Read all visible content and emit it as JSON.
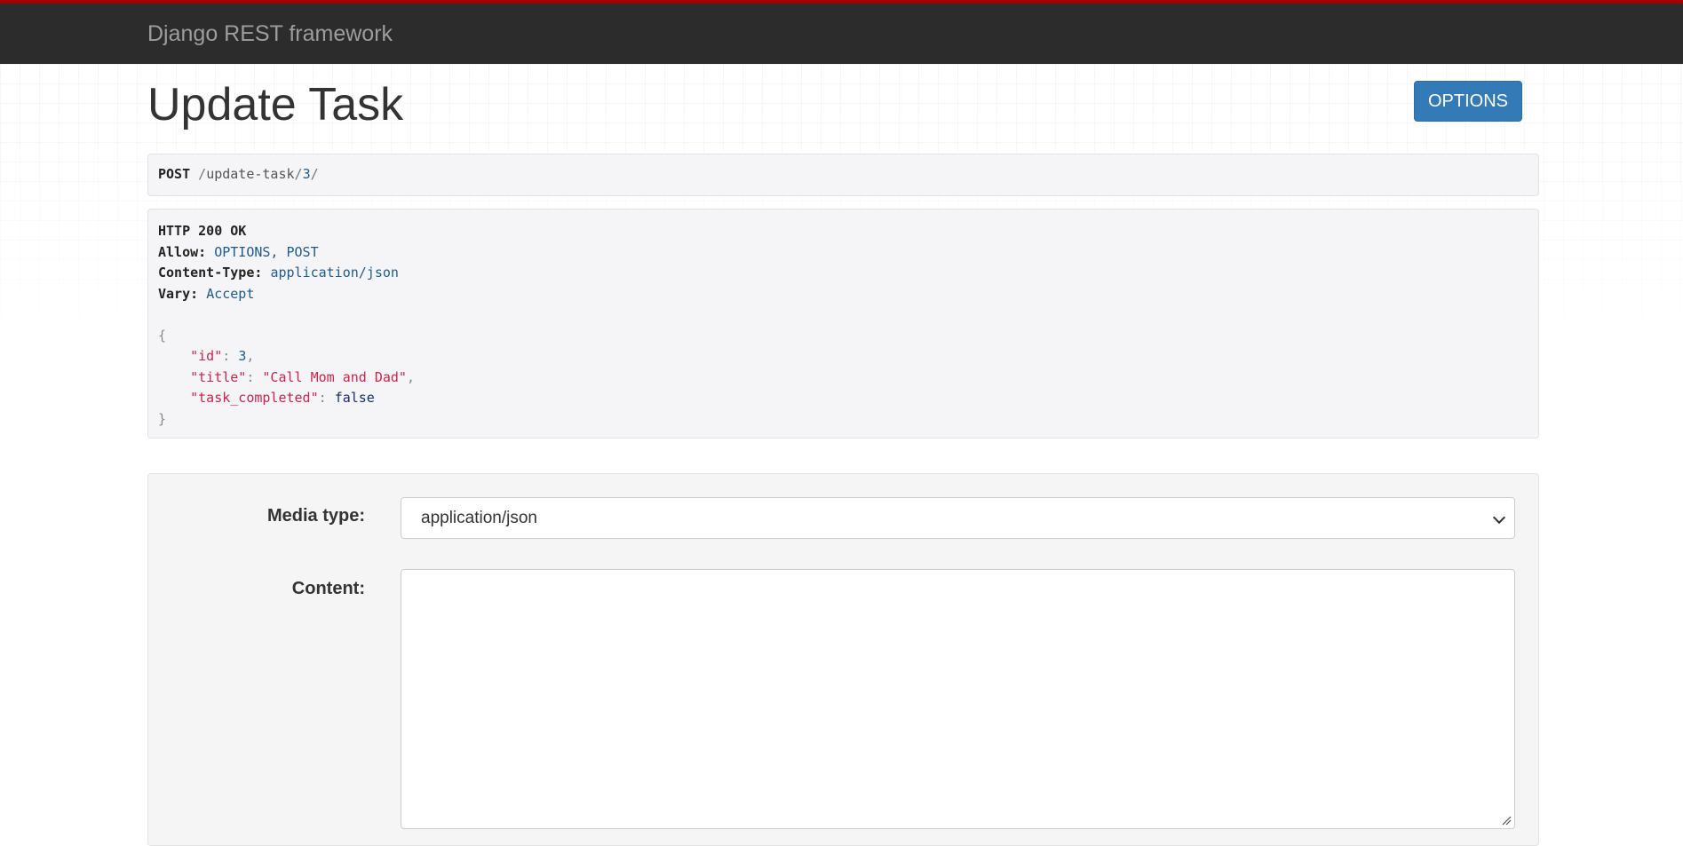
{
  "navbar": {
    "brand": "Django REST framework"
  },
  "page": {
    "title": "Update Task",
    "options_button": "OPTIONS"
  },
  "request": {
    "method": "POST",
    "path_slash_1": "/",
    "path_segment": "update-task",
    "path_slash_2": "/",
    "path_id": "3",
    "path_slash_3": "/"
  },
  "response": {
    "status": "HTTP 200 OK",
    "headers": [
      {
        "key": "Allow:",
        "value": "OPTIONS, POST"
      },
      {
        "key": "Content-Type:",
        "value": "application/json"
      },
      {
        "key": "Vary:",
        "value": "Accept"
      }
    ],
    "body": {
      "open_brace": "{",
      "close_brace": "}",
      "fields": [
        {
          "key": "\"id\"",
          "value": "3",
          "sep": ","
        },
        {
          "key": "\"title\"",
          "value": "\"Call Mom and Dad\"",
          "sep": ","
        },
        {
          "key": "\"task_completed\"",
          "value": "false",
          "sep": ""
        }
      ]
    }
  },
  "form": {
    "media_type_label": "Media type:",
    "media_type_value": "application/json",
    "content_label": "Content:",
    "content_value": ""
  },
  "colors": {
    "navbar_bg": "#2c2c2c",
    "navbar_accent": "#a30000",
    "primary_button": "#337ab7",
    "json_key": "#c7254e",
    "json_number": "#1e5a8a"
  }
}
